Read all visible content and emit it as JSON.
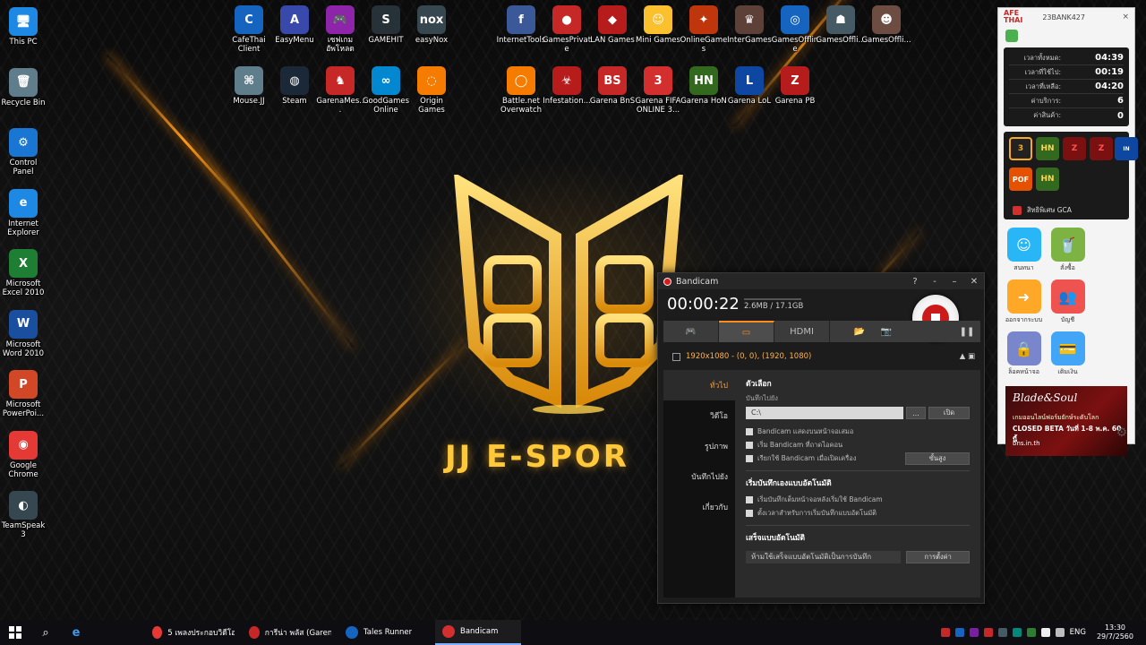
{
  "desktop_left": [
    {
      "label": "This PC",
      "icon": "this-pc-icon",
      "glyph": "🖥",
      "color": "#1e88e5"
    },
    {
      "label": "Recycle Bin",
      "icon": "recycle-bin-icon",
      "glyph": "🗑",
      "color": "#607d8b"
    },
    {
      "label": "Control Panel",
      "icon": "control-panel-icon",
      "glyph": "⚙",
      "color": "#1976d2"
    },
    {
      "label": "Internet Explorer",
      "icon": "internet-explorer-icon",
      "glyph": "e",
      "color": "#1e88e5"
    },
    {
      "label": "Microsoft Excel 2010",
      "icon": "excel-icon",
      "glyph": "X",
      "color": "#1e7e34"
    },
    {
      "label": "Microsoft Word 2010",
      "icon": "word-icon",
      "glyph": "W",
      "color": "#1a4fa0"
    },
    {
      "label": "Microsoft PowerPoi...",
      "icon": "powerpoint-icon",
      "glyph": "P",
      "color": "#d24726"
    },
    {
      "label": "Google Chrome",
      "icon": "chrome-icon",
      "glyph": "◉",
      "color": "#e53935"
    },
    {
      "label": "TeamSpeak 3",
      "icon": "teamspeak-icon",
      "glyph": "◐",
      "color": "#37474f"
    }
  ],
  "desktop_row1": [
    {
      "label": "CafeThai Client",
      "icon": "cafethai-icon",
      "glyph": "C",
      "color": "#1565c0"
    },
    {
      "label": "EasyMenu",
      "icon": "easymenu-icon",
      "glyph": "A",
      "color": "#3949ab"
    },
    {
      "label": "เซฟเกมอัพโหลด",
      "icon": "game-save-icon",
      "glyph": "🎮",
      "color": "#8e24aa"
    },
    {
      "label": "GAMEHIT",
      "icon": "gamehit-icon",
      "glyph": "S",
      "color": "#263238"
    },
    {
      "label": "easyNox",
      "icon": "easynox-icon",
      "glyph": "nox",
      "color": "#37474f"
    },
    {
      "label": "InternetTools",
      "icon": "facebook-icon",
      "glyph": "f",
      "color": "#3b5998"
    },
    {
      "label": "GamesPrivate",
      "icon": "gamesprivate-icon",
      "glyph": "●",
      "color": "#c62828"
    },
    {
      "label": "LAN Games",
      "icon": "lan-games-icon",
      "glyph": "◆",
      "color": "#b71c1c"
    },
    {
      "label": "Mini Games",
      "icon": "mini-games-icon",
      "glyph": "☺",
      "color": "#fbc02d"
    },
    {
      "label": "OnlineGames",
      "icon": "onlinegames-icon",
      "glyph": "✦",
      "color": "#bf360c"
    },
    {
      "label": "InterGames",
      "icon": "intergames-icon",
      "glyph": "♛",
      "color": "#5d4037"
    },
    {
      "label": "GamesOffline",
      "icon": "gamesoffline-icon",
      "glyph": "◎",
      "color": "#1565c0"
    },
    {
      "label": "GamesOffli...",
      "icon": "gamesoffline2-icon",
      "glyph": "☗",
      "color": "#455a64"
    },
    {
      "label": "GamesOffli...",
      "icon": "gamesoffline3-icon",
      "glyph": "☻",
      "color": "#6d4c41"
    }
  ],
  "desktop_row2": [
    {
      "label": "Mouse.JJ",
      "icon": "mouse-icon",
      "glyph": "⌘",
      "color": "#607d8b"
    },
    {
      "label": "Steam",
      "icon": "steam-icon",
      "glyph": "◍",
      "color": "#1b2838"
    },
    {
      "label": "GarenaMes...",
      "icon": "garena-messenger-icon",
      "glyph": "♞",
      "color": "#c62828"
    },
    {
      "label": "GoodGames Online",
      "icon": "goodgames-icon",
      "glyph": "∞",
      "color": "#0288d1"
    },
    {
      "label": "Origin Games",
      "icon": "origin-icon",
      "glyph": "◌",
      "color": "#f57c00"
    },
    {
      "label": "Battle.net Overwatch",
      "icon": "overwatch-icon",
      "glyph": "◯",
      "color": "#f57c00"
    },
    {
      "label": "Infestation...",
      "icon": "infestation-icon",
      "glyph": "☣",
      "color": "#b71c1c"
    },
    {
      "label": "Garena BnS",
      "icon": "garena-bns-icon",
      "glyph": "BS",
      "color": "#c62828"
    },
    {
      "label": "Garena FIFA ONLINE 3...",
      "icon": "fifa-online-icon",
      "glyph": "3",
      "color": "#d32f2f"
    },
    {
      "label": "Garena HoN",
      "icon": "garena-hon-icon",
      "glyph": "HN",
      "color": "#33691e"
    },
    {
      "label": "Garena LoL",
      "icon": "garena-lol-icon",
      "glyph": "L",
      "color": "#0d47a1"
    },
    {
      "label": "Garena PB",
      "icon": "garena-pb-icon",
      "glyph": "Z",
      "color": "#b71c1c"
    }
  ],
  "logo": {
    "text": "JJ E-SPOR"
  },
  "bandicam": {
    "title": "Bandicam",
    "help": "?",
    "timer": "00:00:22",
    "size": "2.6MB / 17.1GB",
    "resolution": "1920x1080 - (0, 0), (1920, 1080)",
    "tabs": [
      "ทั่วไป",
      "วิดีโอ",
      "รูปภาพ",
      "บันทึกไปยัง",
      "เกี่ยวกับ"
    ],
    "section1": "ตัวเลือก",
    "output_label": "บันทึกไปยัง",
    "output_path": "C:\\",
    "browse_btn": "...",
    "open_btn": "เปิด",
    "opt1": "Bandicam แสดงบนหน้าจอเสมอ",
    "opt2": "เริ่ม Bandicam ที่ถาดไอคอน",
    "opt3": "เรียกใช้ Bandicam เมื่อเปิดเครื่อง",
    "advanced_btn": "ขั้นสูง",
    "section2": "เริ่มบันทึกเองแบบอัตโนมัติ",
    "opt4": "เริ่มบันทึกเต็มหน้าจอหลังเริ่มใช้ Bandicam",
    "opt5": "ตั้งเวลาสำหรับการเริ่มบันทึกแบบอัตโนมัติ",
    "section3": "เสร็จแบบอัตโนมัติ",
    "auto_complete": "ห้ามใช้เสร็จแบบอัตโนมัติเป็นการบันทึก",
    "settings_btn": "การตั้งค่า"
  },
  "cafe": {
    "logo_line1": "AFE",
    "logo_line2": "THAI",
    "user": "23BANK427",
    "close": "×",
    "stats": [
      {
        "label": "เวลาทั้งหมด:",
        "value": "04:39"
      },
      {
        "label": "เวลาที่ใช้ไป:",
        "value": "00:19"
      },
      {
        "label": "เวลาที่เหลือ:",
        "value": "04:20"
      },
      {
        "label": "ค่าบริการ:",
        "value": "6"
      },
      {
        "label": "ค่าสินค้า:",
        "value": "0"
      }
    ],
    "gca": "สิทธิพิเศษ GCA",
    "apps": [
      {
        "label": "สนทนา",
        "icon": "chat-icon",
        "glyph": "☺",
        "color": "#29b6f6"
      },
      {
        "label": "สั่งซื้อ",
        "icon": "order-icon",
        "glyph": "🥤",
        "color": "#7cb342"
      },
      {
        "label": "ออกจากระบบ",
        "icon": "logout-icon",
        "glyph": "➜",
        "color": "#ffa726"
      },
      {
        "label": "บัญชี",
        "icon": "account-icon",
        "glyph": "👥",
        "color": "#ef5350"
      },
      {
        "label": "ล็อคหน้าจอ",
        "icon": "lock-icon",
        "glyph": "🔒",
        "color": "#7986cb"
      },
      {
        "label": "เติมเงิน",
        "icon": "topup-icon",
        "glyph": "💳",
        "color": "#42a5f5"
      }
    ],
    "banner": {
      "title": "Blade&Soul",
      "line1": "เกมออนไลน์ฟอร์มยักษ์ระดับโลก",
      "line2": "CLOSED BETA วันที่ 1-8 พ.ค. 60 นี้",
      "line3": "bns.in.th"
    }
  },
  "taskbar": {
    "items": [
      {
        "label": "5 เพลงประกอบวิดีโอเพ...",
        "icon": "chrome-icon",
        "color": "#e53935"
      },
      {
        "label": "การีน่า พลัส (Garena...",
        "icon": "garena-icon",
        "color": "#c62828"
      },
      {
        "label": "Tales Runner",
        "icon": "tales-runner-icon",
        "color": "#1565c0"
      },
      {
        "label": "Bandicam",
        "icon": "bandicam-icon",
        "color": "#d32f2f"
      }
    ],
    "lang": "ENG",
    "time": "13:30",
    "date": "29/7/2560"
  }
}
